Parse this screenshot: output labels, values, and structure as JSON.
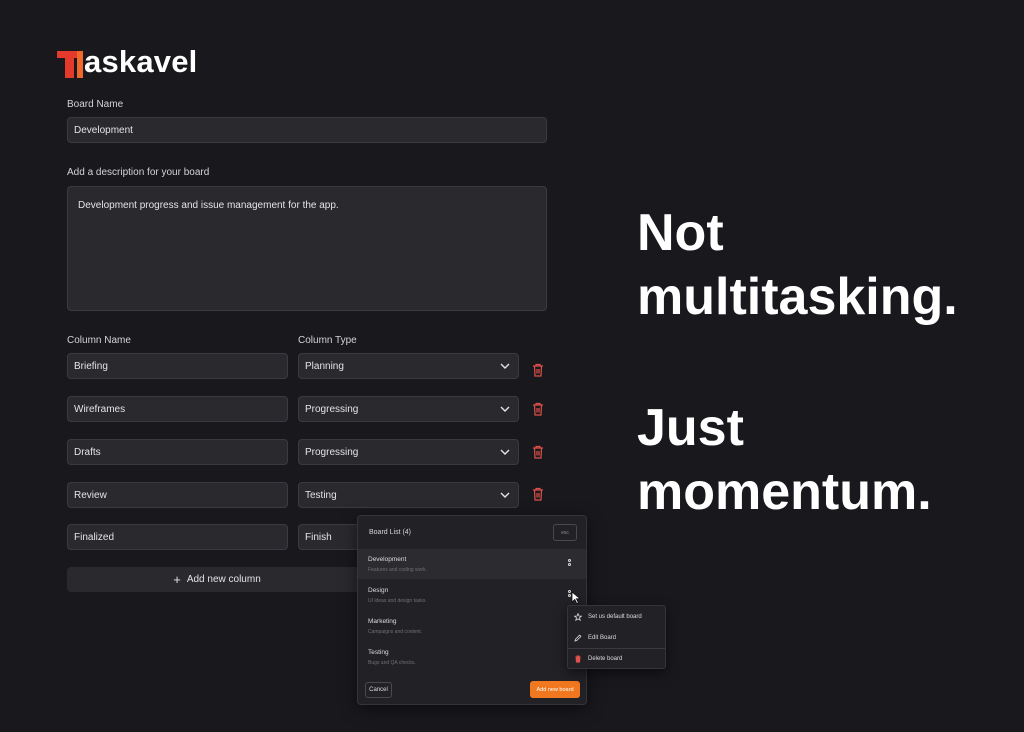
{
  "brand": {
    "logo_letter": "T",
    "logo_rest": "askavel",
    "accent_color": "#e43a2c"
  },
  "form": {
    "board_name_label": "Board Name",
    "board_name_value": "Development",
    "description_label": "Add a description for your board",
    "description_value": "Development progress and issue management for the app.",
    "column_name_header": "Column Name",
    "column_type_header": "Column Type",
    "columns": [
      {
        "name": "Briefing",
        "type": "Planning"
      },
      {
        "name": "Wireframes",
        "type": "Progressing"
      },
      {
        "name": "Drafts",
        "type": "Progressing"
      },
      {
        "name": "Review",
        "type": "Testing"
      },
      {
        "name": "Finalized",
        "type": "Finish"
      }
    ],
    "add_column_label": "Add new column"
  },
  "tagline": {
    "line1": "Not",
    "line2": "multitasking.",
    "line3": "Just",
    "line4": "momentum."
  },
  "board_list": {
    "title": "Board List (4)",
    "esc_label": "esc",
    "boards": [
      {
        "name": "Development",
        "desc": "Features and coding work."
      },
      {
        "name": "Design",
        "desc": "UI ideas and design tasks."
      },
      {
        "name": "Marketing",
        "desc": "Campaigns and content."
      },
      {
        "name": "Testing",
        "desc": "Bugs and QA checks."
      }
    ],
    "cancel_label": "Cancel",
    "add_board_label": "Add new board",
    "add_board_color": "#f2781f"
  },
  "context_menu": {
    "set_default": "Set us default board",
    "edit": "Edit Board",
    "delete": "Delete board"
  }
}
